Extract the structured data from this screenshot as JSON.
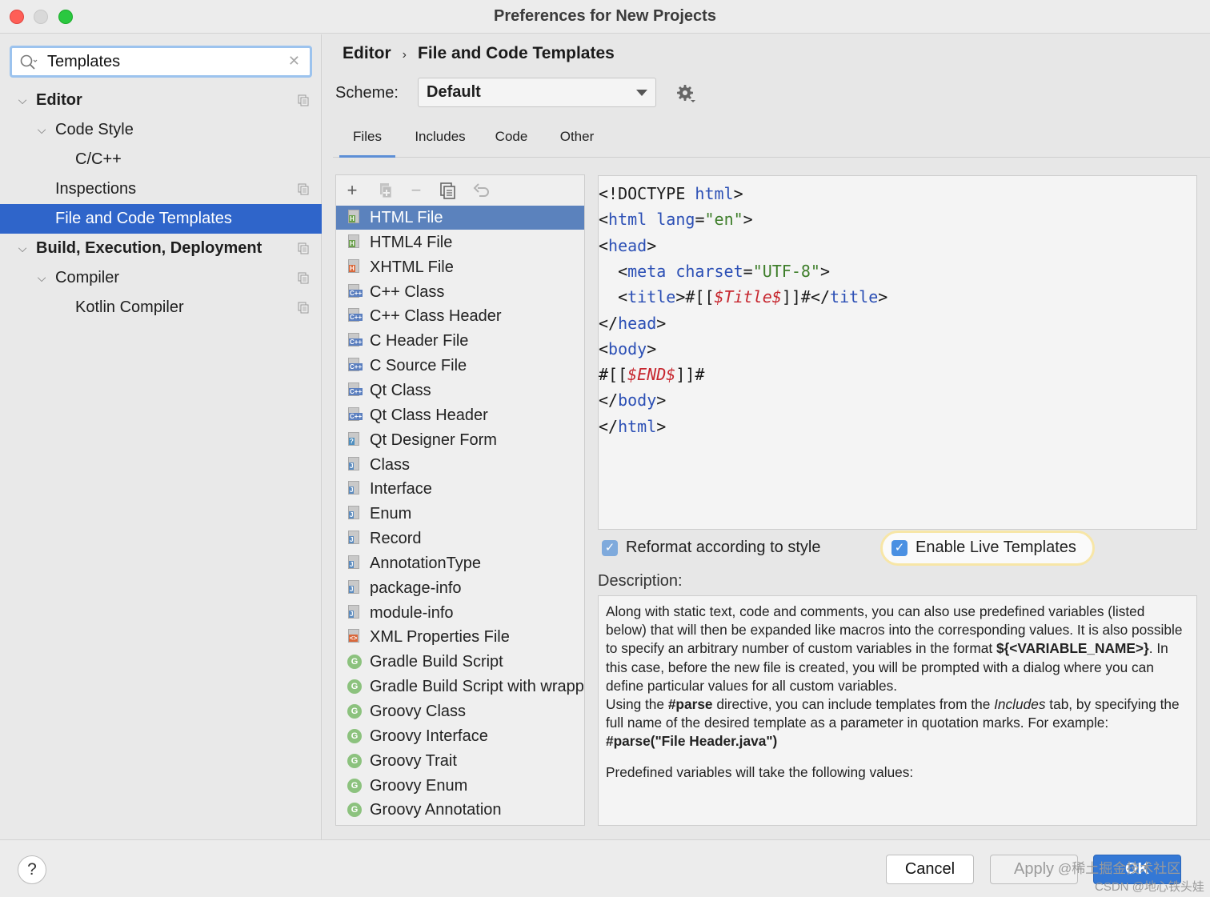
{
  "window": {
    "title": "Preferences for New Projects"
  },
  "sidebar": {
    "search": {
      "value": "Templates"
    },
    "items": [
      {
        "label": "Editor",
        "level": 0,
        "expanded": true,
        "bold": true,
        "copy_icon": true
      },
      {
        "label": "Code Style",
        "level": 1,
        "expanded": true
      },
      {
        "label": "C/C++",
        "level": 2
      },
      {
        "label": "Inspections",
        "level": 1,
        "copy_icon": true
      },
      {
        "label": "File and Code Templates",
        "level": 1,
        "selected": true
      },
      {
        "label": "Build, Execution, Deployment",
        "level": 0,
        "expanded": true,
        "bold": true,
        "copy_icon": true
      },
      {
        "label": "Compiler",
        "level": 1,
        "expanded": true,
        "copy_icon": true
      },
      {
        "label": "Kotlin Compiler",
        "level": 2,
        "copy_icon": true
      }
    ]
  },
  "breadcrumb": {
    "parent": "Editor",
    "separator": "›",
    "current": "File and Code Templates"
  },
  "scheme": {
    "label": "Scheme:",
    "value": "Default"
  },
  "tabs": [
    {
      "label": "Files",
      "active": true
    },
    {
      "label": "Includes"
    },
    {
      "label": "Code"
    },
    {
      "label": "Other"
    }
  ],
  "toolbar": {
    "add": "+",
    "remove": "−"
  },
  "templates": [
    {
      "label": "HTML File",
      "icon": "html-file-icon",
      "badge": "H",
      "badge_color": "#6a9f4b",
      "selected": true
    },
    {
      "label": "HTML4 File",
      "icon": "html-file-icon",
      "badge": "H",
      "badge_color": "#6a9f4b"
    },
    {
      "label": "XHTML File",
      "icon": "html-file-icon",
      "badge": "H",
      "badge_color": "#d9683b"
    },
    {
      "label": "C++ Class",
      "icon": "cpp-file-icon",
      "badge": "C++",
      "badge_color": "#5b7fbf"
    },
    {
      "label": "C++ Class Header",
      "icon": "cpp-file-icon",
      "badge": "C++",
      "badge_color": "#5b7fbf"
    },
    {
      "label": "C Header File",
      "icon": "cpp-file-icon",
      "badge": "C++",
      "badge_color": "#5b7fbf"
    },
    {
      "label": "C Source File",
      "icon": "cpp-file-icon",
      "badge": "C++",
      "badge_color": "#5b7fbf"
    },
    {
      "label": "Qt Class",
      "icon": "cpp-file-icon",
      "badge": "C++",
      "badge_color": "#5b7fbf"
    },
    {
      "label": "Qt Class Header",
      "icon": "cpp-file-icon",
      "badge": "C++",
      "badge_color": "#5b7fbf"
    },
    {
      "label": "Qt Designer Form",
      "icon": "qt-form-icon",
      "badge": "?",
      "badge_color": "#4f8fbf"
    },
    {
      "label": "Class",
      "icon": "java-file-icon",
      "badge": "J",
      "badge_color": "#5b8bbf"
    },
    {
      "label": "Interface",
      "icon": "java-file-icon",
      "badge": "J",
      "badge_color": "#5b8bbf"
    },
    {
      "label": "Enum",
      "icon": "java-file-icon",
      "badge": "J",
      "badge_color": "#5b8bbf"
    },
    {
      "label": "Record",
      "icon": "java-file-icon",
      "badge": "J",
      "badge_color": "#5b8bbf"
    },
    {
      "label": "AnnotationType",
      "icon": "java-file-icon",
      "badge": "J",
      "badge_color": "#5b8bbf"
    },
    {
      "label": "package-info",
      "icon": "java-file-icon",
      "badge": "J",
      "badge_color": "#5b8bbf"
    },
    {
      "label": "module-info",
      "icon": "java-file-icon",
      "badge": "J",
      "badge_color": "#5b8bbf"
    },
    {
      "label": "XML Properties File",
      "icon": "xml-file-icon",
      "badge": "<>",
      "badge_color": "#d9683b"
    },
    {
      "label": "Gradle Build Script",
      "icon": "groovy-icon",
      "badge": "G"
    },
    {
      "label": "Gradle Build Script with wrapper",
      "icon": "groovy-icon",
      "badge": "G"
    },
    {
      "label": "Groovy Class",
      "icon": "groovy-icon",
      "badge": "G"
    },
    {
      "label": "Groovy Interface",
      "icon": "groovy-icon",
      "badge": "G"
    },
    {
      "label": "Groovy Trait",
      "icon": "groovy-icon",
      "badge": "G"
    },
    {
      "label": "Groovy Enum",
      "icon": "groovy-icon",
      "badge": "G"
    },
    {
      "label": "Groovy Annotation",
      "icon": "groovy-icon",
      "badge": "G"
    }
  ],
  "code_lines": [
    [
      {
        "t": "<!DOCTYPE ",
        "c": "plain"
      },
      {
        "t": "html",
        "c": "tag"
      },
      {
        "t": ">",
        "c": "plain"
      }
    ],
    [
      {
        "t": "<",
        "c": "plain"
      },
      {
        "t": "html ",
        "c": "tag"
      },
      {
        "t": "lang",
        "c": "attr"
      },
      {
        "t": "=",
        "c": "plain"
      },
      {
        "t": "\"en\"",
        "c": "str"
      },
      {
        "t": ">",
        "c": "plain"
      }
    ],
    [
      {
        "t": "<",
        "c": "plain"
      },
      {
        "t": "head",
        "c": "tag"
      },
      {
        "t": ">",
        "c": "plain"
      }
    ],
    [
      {
        "t": "  <",
        "c": "plain"
      },
      {
        "t": "meta ",
        "c": "tag"
      },
      {
        "t": "charset",
        "c": "attr"
      },
      {
        "t": "=",
        "c": "plain"
      },
      {
        "t": "\"UTF-8\"",
        "c": "str"
      },
      {
        "t": ">",
        "c": "plain"
      }
    ],
    [
      {
        "t": "  <",
        "c": "plain"
      },
      {
        "t": "title",
        "c": "tag"
      },
      {
        "t": ">#[[",
        "c": "plain"
      },
      {
        "t": "$Title$",
        "c": "var"
      },
      {
        "t": "]]#</",
        "c": "plain"
      },
      {
        "t": "title",
        "c": "tag"
      },
      {
        "t": ">",
        "c": "plain"
      }
    ],
    [
      {
        "t": "</",
        "c": "plain"
      },
      {
        "t": "head",
        "c": "tag"
      },
      {
        "t": ">",
        "c": "plain"
      }
    ],
    [
      {
        "t": "<",
        "c": "plain"
      },
      {
        "t": "body",
        "c": "tag"
      },
      {
        "t": ">",
        "c": "plain"
      }
    ],
    [
      {
        "t": "#[[",
        "c": "plain"
      },
      {
        "t": "$END$",
        "c": "var"
      },
      {
        "t": "]]#",
        "c": "plain"
      }
    ],
    [
      {
        "t": "</",
        "c": "plain"
      },
      {
        "t": "body",
        "c": "tag"
      },
      {
        "t": ">",
        "c": "plain"
      }
    ],
    [
      {
        "t": "</",
        "c": "plain"
      },
      {
        "t": "html",
        "c": "tag"
      },
      {
        "t": ">",
        "c": "plain"
      }
    ]
  ],
  "options": {
    "reformat": {
      "label": "Reformat according to style",
      "checked": true
    },
    "live_templates": {
      "label": "Enable Live Templates",
      "checked": true
    }
  },
  "description": {
    "label": "Description:",
    "p1_a": "Along with static text, code and comments, you can also use predefined variables (listed below) that will then be expanded like macros into the corresponding values. It is also possible to specify an arbitrary number of custom variables in the format ",
    "p1_b": "${<VARIABLE_NAME>}",
    "p1_c": ". In this case, before the new file is created, you will be prompted with a dialog where you can define particular values for all custom variables.",
    "p2_a": "Using the ",
    "p2_b": "#parse",
    "p2_c": " directive, you can include templates from the ",
    "p2_d": "Includes",
    "p2_e": " tab, by specifying the full name of the desired template as a parameter in quotation marks. For example:",
    "p3": "#parse(\"File Header.java\")",
    "p4": "Predefined variables will take the following values:"
  },
  "buttons": {
    "help": "?",
    "cancel": "Cancel",
    "apply": "Apply",
    "ok": "OK"
  },
  "watermark": {
    "line1": "@稀土掘金技术社区",
    "line2": "CSDN @地心铁头娃"
  }
}
